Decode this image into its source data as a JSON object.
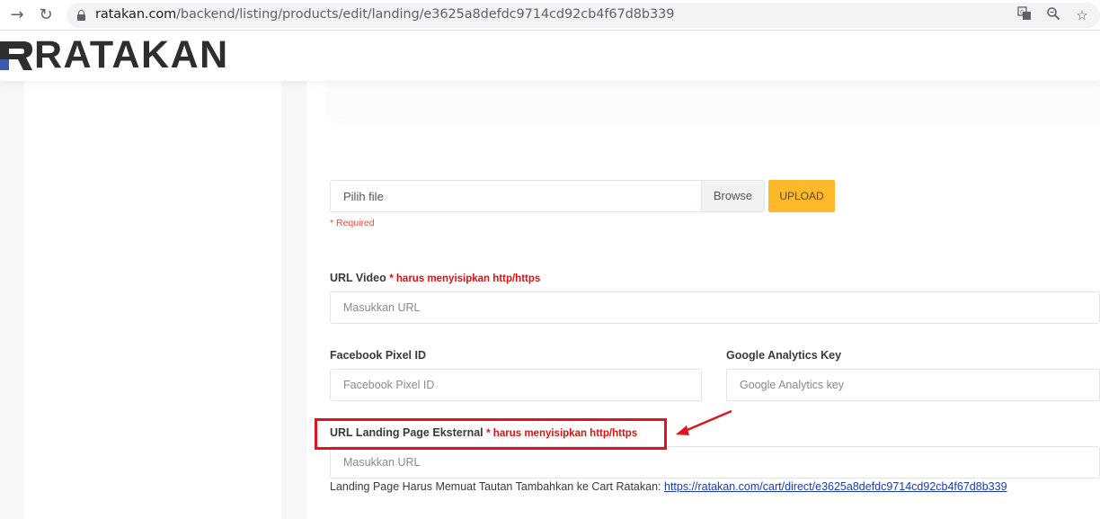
{
  "browser": {
    "url_host": "ratakan.com",
    "url_path": "/backend/listing/products/edit/landing/e3625a8defdc9714cd92cb4f67d8b339"
  },
  "header": {
    "logo_text": "RATAKAN"
  },
  "form": {
    "file_placeholder": "Pilih file",
    "browse_label": "Browse",
    "upload_label": "UPLOAD",
    "required_text": "* Required",
    "url_video": {
      "label": "URL Video",
      "note": "* harus menyisipkan http/https",
      "placeholder": "Masukkan URL"
    },
    "facebook_pixel": {
      "label": "Facebook Pixel ID",
      "placeholder": "Facebook Pixel ID"
    },
    "google_analytics": {
      "label": "Google Analytics Key",
      "placeholder": "Google Analytics key"
    },
    "landing_url": {
      "label": "URL Landing Page Eksternal",
      "note": "* harus menyisipkan http/https",
      "placeholder": "Masukkan URL"
    },
    "hint_text": "Landing Page Harus Memuat Tautan Tambahkan ke Cart Ratakan:",
    "hint_link": "https://ratakan.com/cart/direct/e3625a8defdc9714cd92cb4f67d8b339"
  },
  "colors": {
    "accent_upload": "#fdb92a",
    "annotation_red": "#e0141e",
    "link_blue": "#1a3bb8"
  }
}
